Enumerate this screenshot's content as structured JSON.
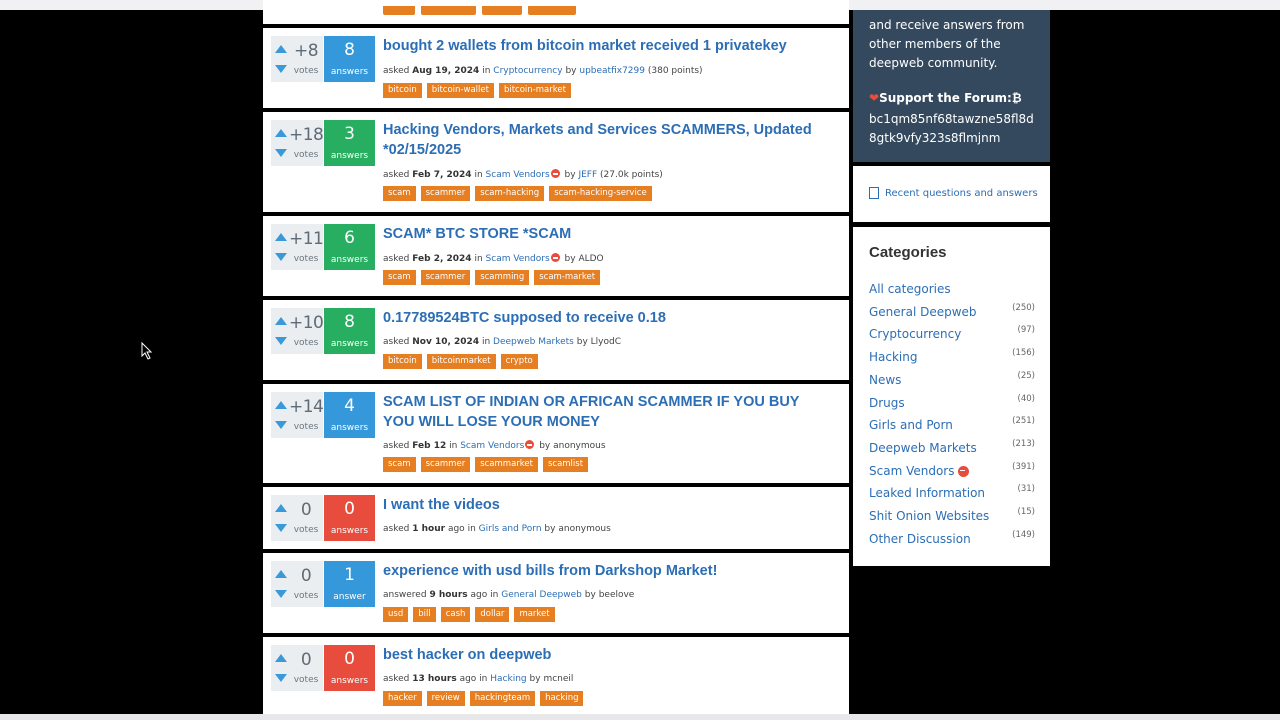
{
  "questions": [
    {
      "votes": "+8",
      "votes_label": "votes",
      "answers": "8",
      "answers_label": "answers",
      "answer_color": "#3498db",
      "title": "bought 2 wallets from bitcoin market received 1 privatekey",
      "meta": {
        "verb": "asked",
        "when": "Aug 19, 2024",
        "in": "in",
        "category": "Cryptocurrency",
        "by": "by",
        "user": "upbeatfix7299",
        "points": "(380 points)"
      },
      "tags": [
        "bitcoin",
        "bitcoin-wallet",
        "bitcoin-market"
      ]
    },
    {
      "votes": "+18",
      "votes_label": "votes",
      "answers": "3",
      "answers_label": "answers",
      "answer_color": "#27ae60",
      "title": "Hacking Vendors, Markets and Services SCAMMERS, Updated *02/15/2025",
      "meta": {
        "verb": "asked",
        "when": "Feb 7, 2024",
        "in": "in",
        "category": "Scam Vendors",
        "by": "by",
        "user": "JEFF",
        "points": "(27.0k points)"
      },
      "tags": [
        "scam",
        "scammer",
        "scam-hacking",
        "scam-hacking-service"
      ]
    },
    {
      "votes": "+11",
      "votes_label": "votes",
      "answers": "6",
      "answers_label": "answers",
      "answer_color": "#27ae60",
      "title": "SCAM* BTC STORE *SCAM",
      "meta": {
        "verb": "asked",
        "when": "Feb 2, 2024",
        "in": "in",
        "category": "Scam Vendors",
        "by": "by",
        "user": "ALDO",
        "points": ""
      },
      "tags": [
        "scam",
        "scammer",
        "scamming",
        "scam-market"
      ]
    },
    {
      "votes": "+10",
      "votes_label": "votes",
      "answers": "8",
      "answers_label": "answers",
      "answer_color": "#27ae60",
      "title": "0.17789524BTC supposed to receive 0.18",
      "meta": {
        "verb": "asked",
        "when": "Nov 10, 2024",
        "in": "in",
        "category": "Deepweb Markets",
        "by": "by",
        "user": "LlyodC",
        "points": ""
      },
      "tags": [
        "bitcoin",
        "bitcoinmarket",
        "crypto"
      ]
    },
    {
      "votes": "+14",
      "votes_label": "votes",
      "answers": "4",
      "answers_label": "answers",
      "answer_color": "#3498db",
      "title": "SCAM LIST OF INDIAN OR AFRICAN SCAMMER IF YOU BUY YOU WILL LOSE YOUR MONEY",
      "meta": {
        "verb": "asked",
        "when": "Feb 12",
        "in": "in",
        "category": "Scam Vendors",
        "by": "by",
        "user": "anonymous",
        "points": ""
      },
      "tags": [
        "scam",
        "scammer",
        "scammarket",
        "scamlist"
      ]
    },
    {
      "votes": "0",
      "votes_label": "votes",
      "answers": "0",
      "answers_label": "answers",
      "answer_color": "#e74c3c",
      "title": "I want the videos",
      "meta": {
        "verb": "asked",
        "when": "1 hour",
        "ago": "ago",
        "in": "in",
        "category": "Girls and Porn",
        "by": "by",
        "user": "anonymous",
        "points": ""
      },
      "tags": []
    },
    {
      "votes": "0",
      "votes_label": "votes",
      "answers": "1",
      "answers_label": "answer",
      "answer_color": "#3498db",
      "title": "experience with usd bills from Darkshop Market!",
      "meta": {
        "verb": "answered",
        "when": "9 hours",
        "ago": "ago",
        "in": "in",
        "category": "General Deepweb",
        "by": "by",
        "user": "beelove",
        "points": ""
      },
      "tags": [
        "usd",
        "bill",
        "cash",
        "dollar",
        "market"
      ]
    },
    {
      "votes": "0",
      "votes_label": "votes",
      "answers": "0",
      "answers_label": "answers",
      "answer_color": "#e74c3c",
      "title": "best hacker on deepweb",
      "meta": {
        "verb": "asked",
        "when": "13 hours",
        "ago": "ago",
        "in": "in",
        "category": "Hacking",
        "by": "by",
        "user": "mcneil",
        "points": ""
      },
      "tags": [
        "hacker",
        "review",
        "hackingteam",
        "hacking"
      ]
    }
  ],
  "sidebar": {
    "ask_text": "and receive answers from other members of the deepweb community.",
    "support_label": "Support the Forum:",
    "btc_symbol": "₿",
    "btc_address": "bc1qm85nf68tawzne58fl8d8gtk9vfy323s8flmjnm",
    "recent_link": "Recent questions and answers",
    "categories_title": "Categories",
    "categories": [
      {
        "name": "All categories",
        "count": ""
      },
      {
        "name": "General Deepweb",
        "count": "(250)"
      },
      {
        "name": "Cryptocurrency",
        "count": "(97)"
      },
      {
        "name": "Hacking",
        "count": "(156)"
      },
      {
        "name": "News",
        "count": "(25)"
      },
      {
        "name": "Drugs",
        "count": "(40)"
      },
      {
        "name": "Girls and Porn",
        "count": "(251)"
      },
      {
        "name": "Deepweb Markets",
        "count": "(213)"
      },
      {
        "name": "Scam Vendors",
        "count": "(391)",
        "flag": true
      },
      {
        "name": "Leaked Information",
        "count": "(31)"
      },
      {
        "name": "Shit Onion Websites",
        "count": "(15)"
      },
      {
        "name": "Other Discussion",
        "count": "(149)"
      }
    ]
  }
}
